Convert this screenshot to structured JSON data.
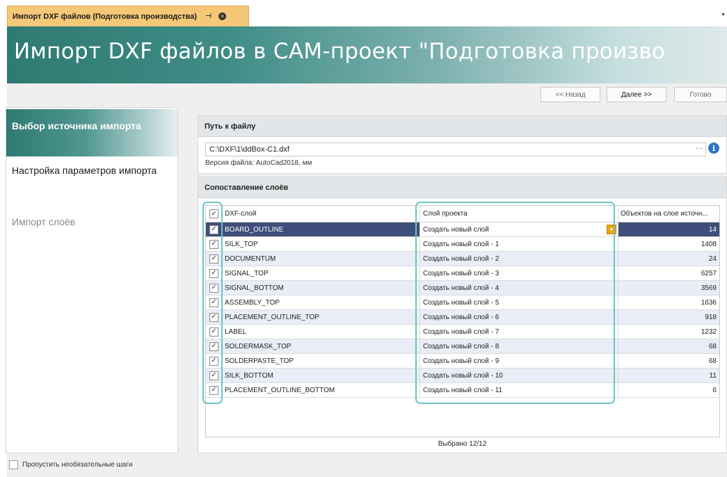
{
  "tab": {
    "title": "Импорт DXF файлов (Подготовка производства)",
    "pin_icon": "pin-icon",
    "close_icon": "close-icon"
  },
  "banner": {
    "title": "Импорт DXF файлов в CAM-проект \"Подготовка произво"
  },
  "nav": {
    "back": "<< Назад",
    "next": "Далее >>",
    "done": "Готово"
  },
  "steps": [
    {
      "label": "Выбор источника импорта"
    },
    {
      "label": "Настройка параметров импорта"
    },
    {
      "label": "Импорт слоёв"
    }
  ],
  "skip_label": "Пропустить необязательные шаги",
  "file_group": {
    "title": "Путь к файлу",
    "path": "C:\\DXF\\1\\ddBox-C1.dxf",
    "ellipsis": "···",
    "version": "Версия файла: AutoCad2018, мм"
  },
  "layers_group": {
    "title": "Сопоставление слоёв",
    "columns": {
      "dxf": "DXF-слой",
      "project": "Слой проекта",
      "count": "Объектов на слое источн..."
    },
    "rows": [
      {
        "dxf": "BOARD_OUTLINE",
        "project": "Создать новый слой",
        "count": "14"
      },
      {
        "dxf": "SILK_TOP",
        "project": "Создать новый слой - 1",
        "count": "1408"
      },
      {
        "dxf": "DOCUMENTUM",
        "project": "Создать новый слой - 2",
        "count": "24"
      },
      {
        "dxf": "SIGNAL_TOP",
        "project": "Создать новый слой - 3",
        "count": "6257"
      },
      {
        "dxf": "SIGNAL_BOTTOM",
        "project": "Создать новый слой - 4",
        "count": "3569"
      },
      {
        "dxf": "ASSEMBLY_TOP",
        "project": "Создать новый слой - 5",
        "count": "1636"
      },
      {
        "dxf": "PLACEMENT_OUTLINE_TOP",
        "project": "Создать новый слой - 6",
        "count": "918"
      },
      {
        "dxf": "LABEL",
        "project": "Создать новый слой - 7",
        "count": "1232"
      },
      {
        "dxf": "SOLDERMASK_TOP",
        "project": "Создать новый слой - 8",
        "count": "68"
      },
      {
        "dxf": "SOLDERPASTE_TOP",
        "project": "Создать новый слой - 9",
        "count": "68"
      },
      {
        "dxf": "SILK_BOTTOM",
        "project": "Создать новый слой - 10",
        "count": "11"
      },
      {
        "dxf": "PLACEMENT_OUTLINE_BOTTOM",
        "project": "Создать новый слой - 11",
        "count": "6"
      }
    ],
    "selected_text": "Выбрано 12/12"
  },
  "colors": {
    "accent": "#2f7a72",
    "tab": "#f5c878",
    "selection": "#3f4e7a",
    "highlight": "#6cc3c7"
  }
}
